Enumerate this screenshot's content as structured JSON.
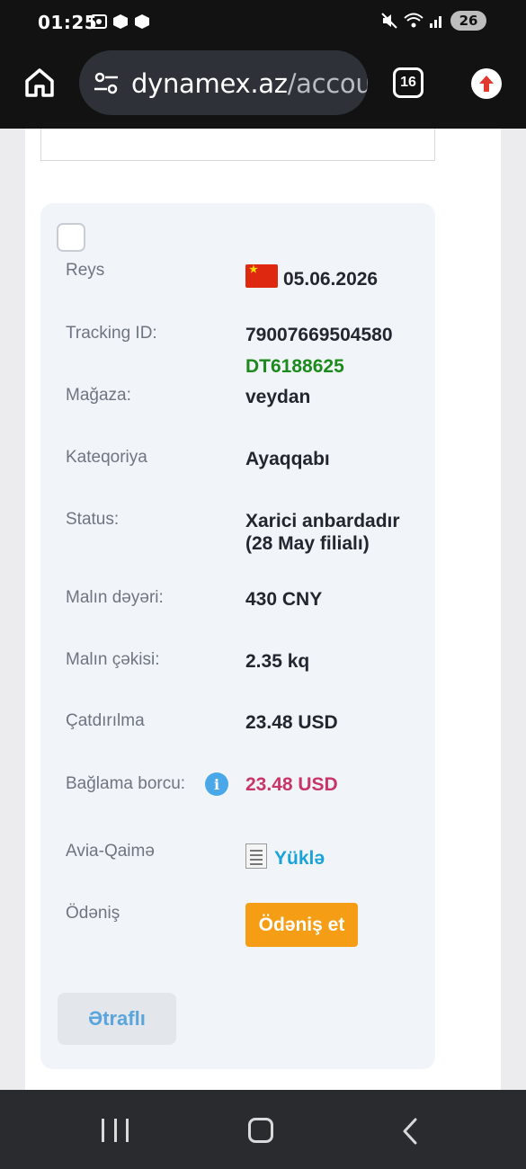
{
  "status_bar": {
    "time": "01:25",
    "battery": "26"
  },
  "browser": {
    "url_host": "dynamex.az",
    "url_path": "/accou",
    "tab_count": "16"
  },
  "package": {
    "rows": [
      {
        "label": "Reys",
        "value": "05.06.2026",
        "flag": "china-flag"
      },
      {
        "label": "Tracking ID:",
        "value": "79007669504580",
        "value2": "DT6188625"
      },
      {
        "label": "Mağaza:",
        "value": "veydan"
      },
      {
        "label": "Kateqoriya",
        "value": "Ayaqqabı"
      },
      {
        "label": "Status:",
        "value": "Xarici anbardadır",
        "value2": "(28 May filialı)"
      },
      {
        "label": "Malın dəyəri:",
        "value": "430 CNY"
      },
      {
        "label": "Malın çəkisi:",
        "value": "2.35 kq"
      },
      {
        "label": "Çatdırılma",
        "value": "23.48 USD"
      },
      {
        "label": "Bağlama borcu:",
        "value": "23.48 USD"
      },
      {
        "label": "Avia-Qaimə",
        "value": "Yüklə"
      },
      {
        "label": "Ödəniş",
        "value": "Ödəniş et"
      }
    ],
    "details_label": "Ətraflı"
  },
  "colors": {
    "accent_orange": "#f59d14",
    "debt_pink": "#c8356a",
    "tracking_green": "#1d8a1d",
    "link_blue": "#1aa3d9"
  }
}
